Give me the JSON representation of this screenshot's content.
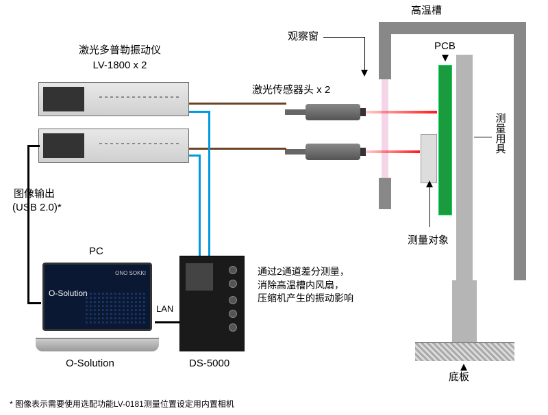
{
  "labels": {
    "chamber": "高温槽",
    "window": "观察窗",
    "vibrometer_title": "激光多普勒振动仪",
    "vibrometer_model": "LV-1800 x 2",
    "sensor_heads": "激光传感器头 x 2",
    "pcb": "PCB",
    "fixture": "测量用具",
    "meas_obj": "测量对象",
    "base": "底板",
    "image_out1": "图像输出",
    "image_out2": "(USB 2.0)*",
    "pc": "PC",
    "osolution": "O-Solution",
    "ds5000": "DS-5000",
    "lan": "LAN",
    "laptop_brand": "ONO SOKKI",
    "laptop_product": "O-Solution"
  },
  "description": {
    "line1": "通过2通道差分测量，",
    "line2": "消除高温槽内风扇，",
    "line3": "压缩机产生的振动影响"
  },
  "footnote": "* 图像表示需要使用选配功能LV-0181测量位置设定用内置相机"
}
